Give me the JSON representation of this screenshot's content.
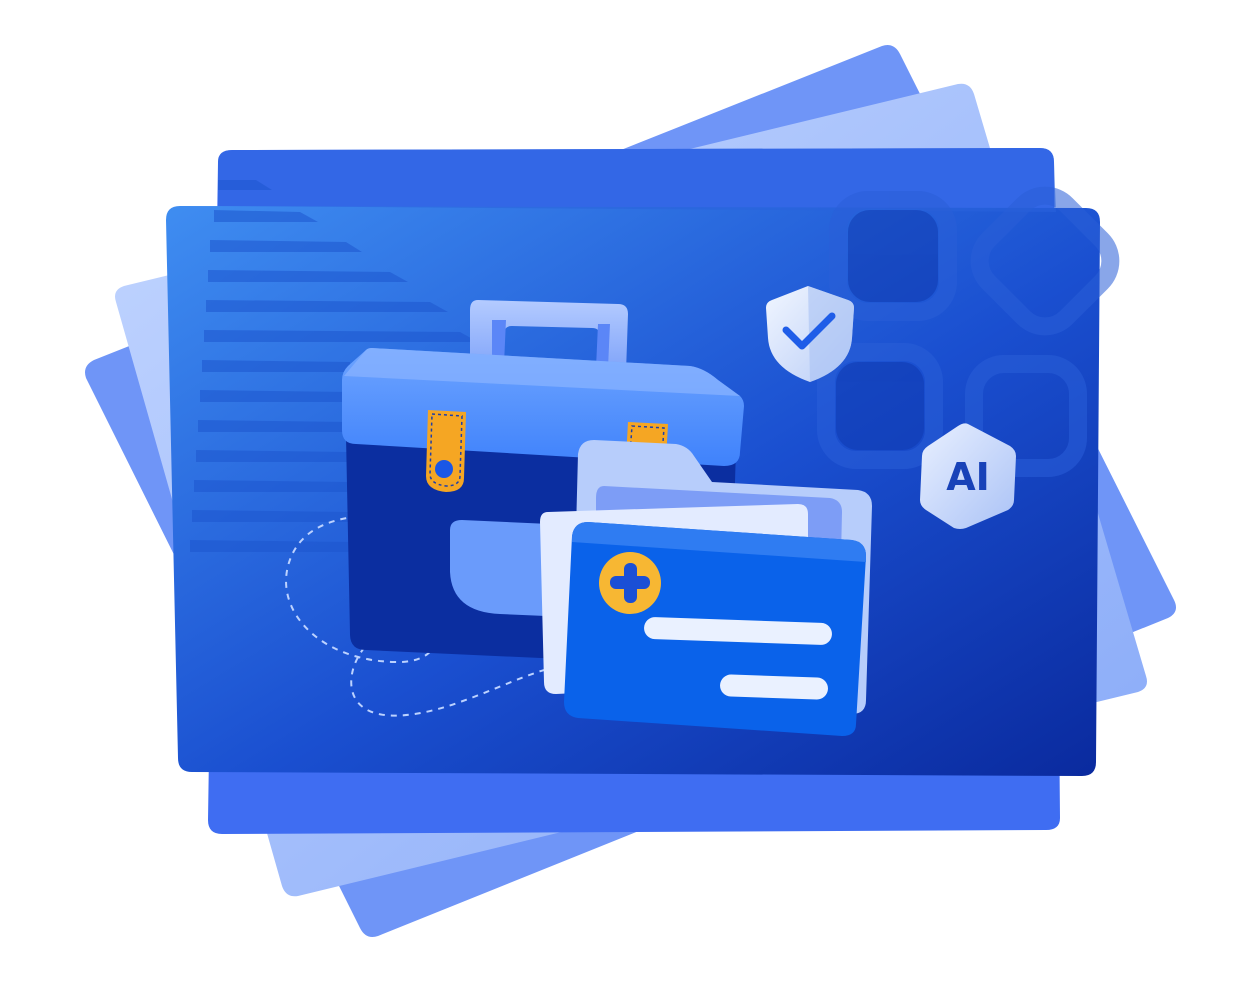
{
  "illustration": {
    "badge_text": "AI",
    "colors": {
      "background": "#ffffff",
      "card_gradient_start": "#3d8cf0",
      "card_gradient_end": "#0a2ea6",
      "back_card_1": "#6f95f7",
      "back_card_2": "#9dbcf9",
      "back_card_3": "#3f6df2",
      "toolbox_lid": "#4c8cff",
      "toolbox_body": "#0b2ea0",
      "latch": "#f5a623",
      "folder_front": "#0a62ea",
      "folder_back": "#b7cdfb",
      "plus_badge": "#f7b733",
      "shield": "#d7e4ff",
      "check": "#1f5de8"
    },
    "icons": [
      "toolbox-icon",
      "folder-icon",
      "plus-icon",
      "shield-check-icon",
      "ai-badge-icon"
    ]
  }
}
